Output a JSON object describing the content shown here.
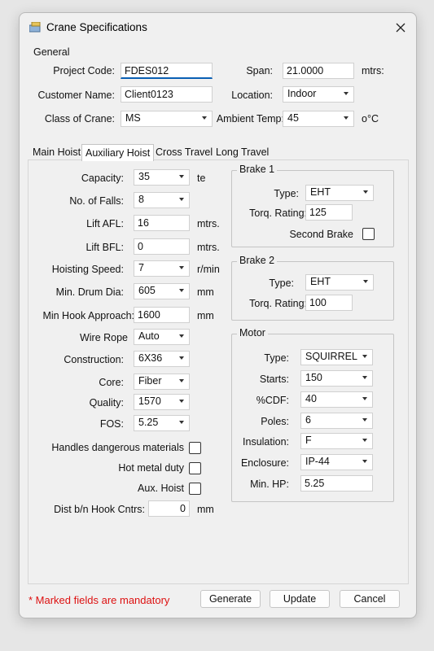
{
  "window": {
    "title": "Crane Specifications"
  },
  "general": {
    "title": "General",
    "project_code_label": "Project Code:",
    "project_code_value": "FDES012",
    "span_label": "Span:",
    "span_value": "21.0000",
    "span_unit": "mtrs:",
    "customer_name_label": "Customer Name:",
    "customer_name_value": "Client0123",
    "location_label": "Location:",
    "location_value": "Indoor",
    "class_label": "Class of Crane:",
    "class_value": "MS",
    "ambient_label": "Ambient Temp:",
    "ambient_value": "45",
    "ambient_unit": "o°C"
  },
  "tabs": [
    "Main Hoist",
    "Auxiliary Hoist",
    "Cross Travel",
    "Long Travel"
  ],
  "active_tab": "Auxiliary Hoist",
  "hoist": {
    "capacity_label": "Capacity:",
    "capacity_value": "35",
    "capacity_unit": "te",
    "falls_label": "No. of Falls:",
    "falls_value": "8",
    "lift_afl_label": "Lift AFL:",
    "lift_afl_value": "16",
    "lift_afl_unit": "mtrs.",
    "lift_bfl_label": "Lift BFL:",
    "lift_bfl_value": "0",
    "lift_bfl_unit": "mtrs.",
    "speed_label": "Hoisting Speed:",
    "speed_value": "7",
    "speed_unit": "r/min",
    "drum_label": "Min. Drum Dia:",
    "drum_value": "605",
    "drum_unit": "mm",
    "hook_label": "Min Hook Approach:",
    "hook_value": "1600",
    "hook_unit": "mm",
    "wire_label": "Wire Rope",
    "wire_value": "Auto",
    "construction_label": "Construction:",
    "construction_value": "6X36",
    "core_label": "Core:",
    "core_value": "Fiber",
    "quality_label": "Quality:",
    "quality_value": "1570",
    "fos_label": "FOS:",
    "fos_value": "5.25",
    "dangerous_label": "Handles dangerous materials",
    "hot_metal_label": "Hot metal duty",
    "aux_hoist_label": "Aux. Hoist",
    "dist_label": "Dist b/n Hook Cntrs:",
    "dist_value": "0",
    "dist_unit": "mm"
  },
  "brake1": {
    "title": "Brake 1",
    "type_label": "Type:",
    "type_value": "EHT",
    "torq_label": "Torq. Rating:",
    "torq_value": "125",
    "second_label": "Second Brake"
  },
  "brake2": {
    "title": "Brake 2",
    "type_label": "Type:",
    "type_value": "EHT",
    "torq_label": "Torq. Rating:",
    "torq_value": "100"
  },
  "motor": {
    "title": "Motor",
    "type_label": "Type:",
    "type_value": "SQUIRREL",
    "starts_label": "Starts:",
    "starts_value": "150",
    "cdf_label": "%CDF:",
    "cdf_value": "40",
    "poles_label": "Poles:",
    "poles_value": "6",
    "insulation_label": "Insulation:",
    "insulation_value": "F",
    "enclosure_label": "Enclosure:",
    "enclosure_value": "IP-44",
    "hp_label": "Min. HP:",
    "hp_value": "5.25"
  },
  "footer": {
    "mandatory_note": "* Marked fields are mandatory",
    "generate_label": "Generate",
    "update_label": "Update",
    "cancel_label": "Cancel"
  }
}
